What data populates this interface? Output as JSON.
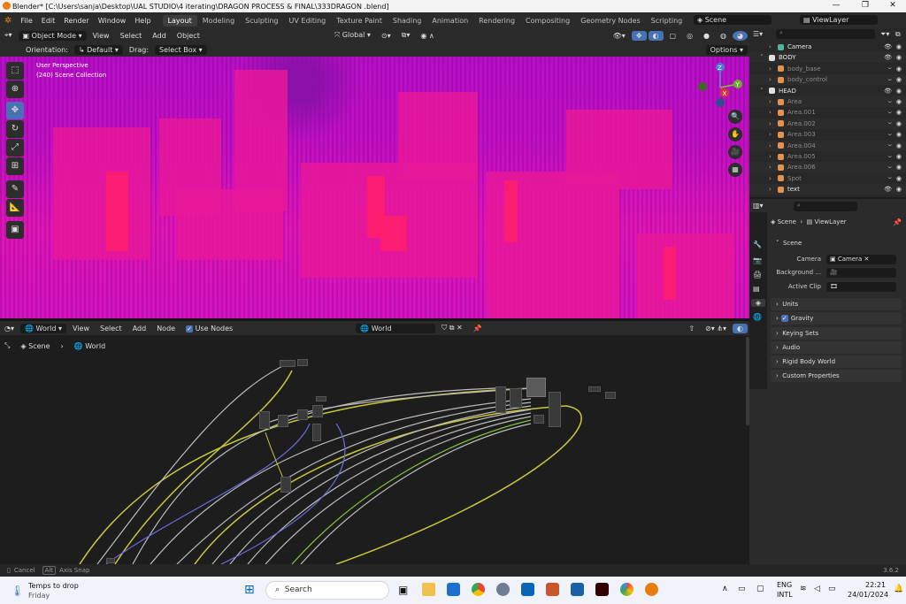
{
  "titlebar": {
    "title": "Blender* [C:\\Users\\sanja\\Desktop\\UAL STUDIO\\4 iterating\\DRAGON PROCESS & FINAL\\333DRAGON .blend]"
  },
  "menus": [
    "File",
    "Edit",
    "Render",
    "Window",
    "Help"
  ],
  "workspaces": [
    "Layout",
    "Modeling",
    "Sculpting",
    "UV Editing",
    "Texture Paint",
    "Shading",
    "Animation",
    "Rendering",
    "Compositing",
    "Geometry Nodes",
    "Scripting"
  ],
  "active_workspace": "Layout",
  "scene_field": "Scene",
  "viewlayer_field": "ViewLayer",
  "viewport": {
    "mode": "Object Mode",
    "menu": [
      "View",
      "Select",
      "Add",
      "Object"
    ],
    "orientation_label": "Orientation:",
    "orientation_value": "Default",
    "drag_label": "Drag:",
    "drag_value": "Select Box",
    "transform": "Global",
    "options": "Options",
    "overlay_title": "User Perspective",
    "overlay_collection": "(240) Scene Collection",
    "gizmo_axes": [
      "X",
      "Y",
      "Z"
    ]
  },
  "node_editor": {
    "type": "World",
    "menu": [
      "View",
      "Select",
      "Add",
      "Node"
    ],
    "use_nodes": "Use Nodes",
    "world_field": "World",
    "breadcrumb": [
      "Scene",
      "World"
    ]
  },
  "outliner": {
    "search_placeholder": "",
    "rows": [
      {
        "name": "Camera",
        "indent": 1,
        "color": "#4fb3a5",
        "vis": true
      },
      {
        "name": "BODY",
        "indent": 0,
        "color": "#e0e0e0",
        "vis": true
      },
      {
        "name": "body_base",
        "indent": 1,
        "color": "#e3934e",
        "vis": false
      },
      {
        "name": "body_control",
        "indent": 1,
        "color": "#e3934e",
        "vis": false
      },
      {
        "name": "HEAD",
        "indent": 0,
        "color": "#e0e0e0",
        "vis": true
      },
      {
        "name": "Area",
        "indent": 1,
        "color": "#e3934e",
        "vis": false
      },
      {
        "name": "Area.001",
        "indent": 1,
        "color": "#e3934e",
        "vis": false
      },
      {
        "name": "Area.002",
        "indent": 1,
        "color": "#e3934e",
        "vis": false
      },
      {
        "name": "Area.003",
        "indent": 1,
        "color": "#e3934e",
        "vis": false
      },
      {
        "name": "Area.004",
        "indent": 1,
        "color": "#e3934e",
        "vis": false
      },
      {
        "name": "Area.005",
        "indent": 1,
        "color": "#e3934e",
        "vis": false
      },
      {
        "name": "Area.006",
        "indent": 1,
        "color": "#e3934e",
        "vis": false
      },
      {
        "name": "Spot",
        "indent": 1,
        "color": "#e3934e",
        "vis": false
      },
      {
        "name": "text",
        "indent": 1,
        "color": "#e3934e",
        "vis": true
      }
    ]
  },
  "properties": {
    "breadcrumb": [
      "Scene",
      "ViewLayer"
    ],
    "scene_section": "Scene",
    "fields": [
      {
        "label": "Camera",
        "value": "Camera"
      },
      {
        "label": "Background ...",
        "value": ""
      },
      {
        "label": "Active Clip",
        "value": ""
      }
    ],
    "sections": [
      "Units",
      "Gravity",
      "Keying Sets",
      "Audio",
      "Rigid Body World",
      "Custom Properties"
    ]
  },
  "statusbar": {
    "cancel": "Cancel",
    "alt": "Alt",
    "axis_snap": "Axis Snap",
    "version": "3.6.2"
  },
  "taskbar": {
    "weather_title": "Temps to drop",
    "weather_sub": "Friday",
    "search": "Search",
    "lang_top": "ENG",
    "lang_bottom": "INTL",
    "time": "22:21",
    "date": "24/01/2024"
  },
  "colors": {
    "accent": "#4772b3",
    "viewport_magenta": "#c40fc5",
    "orange": "#e87d0d"
  }
}
